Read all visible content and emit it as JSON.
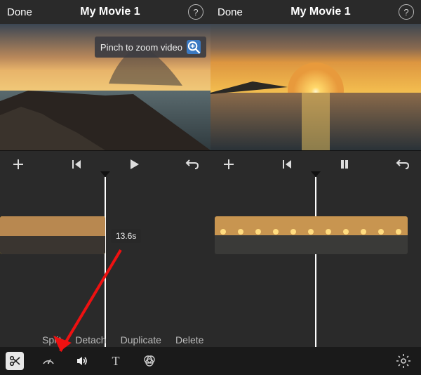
{
  "left": {
    "header": {
      "done": "Done",
      "title": "My Movie 1",
      "help": "?"
    },
    "zoom_hint": "Pinch to zoom video",
    "duration": "13.6s",
    "actions": {
      "split": "Split",
      "detach": "Detach",
      "duplicate": "Duplicate",
      "delete": "Delete"
    }
  },
  "right": {
    "header": {
      "done": "Done",
      "title": "My Movie 1",
      "help": "?"
    }
  },
  "toolbar": {
    "text_tool": "T"
  }
}
